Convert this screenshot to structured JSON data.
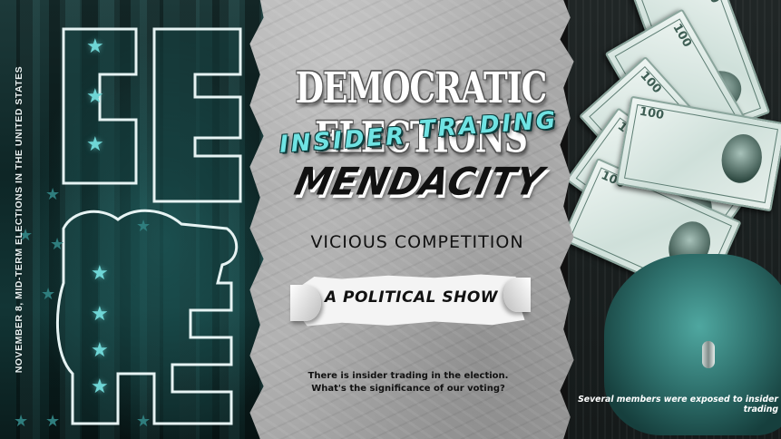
{
  "poster": {
    "side_text": "NOVEMBER 8, MID-TERM ELECTIONS IN THE UNITED STATES",
    "title": "DEMOCRATIC ELECTIONS",
    "keyword_1": "INSIDER",
    "keyword_2": "TRADING",
    "headline": "MENDACITY",
    "subheadline": "VICIOUS COMPETITION",
    "banner_label": "A POLITICAL SHOW",
    "question_line_1": "There is insider trading in the election.",
    "question_line_2": "What's the significance of our voting?",
    "caption": "Several members were exposed to insider trading"
  },
  "colors": {
    "accent_teal": "#6fe3e3",
    "paper_gray": "#b3b3b3",
    "dark_teal": "#0e2626"
  },
  "icons": [
    "star-icon",
    "dollar-bill-icon"
  ]
}
